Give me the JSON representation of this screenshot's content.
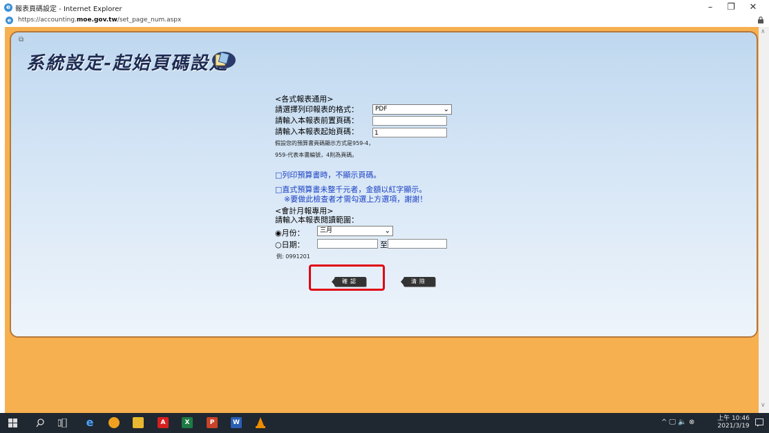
{
  "window": {
    "title": "報表頁碼設定 - Internet Explorer",
    "url_prefix": "https://accounting.",
    "url_domain": "moe.gov.tw",
    "url_path": "/set_page_num.aspx",
    "minimize": "–",
    "maximize": "❐",
    "close": "✕"
  },
  "page": {
    "heading": "系統設定-起始頁碼設定",
    "general_section": "<各式報表通用>",
    "format_label": "請選擇列印報表的格式：",
    "format_value": "PDF",
    "front_page_label": "請輸入本報表前置頁碼：",
    "front_page_value": "",
    "start_page_label": "請輸入本報表起始頁碼：",
    "start_page_value": "1",
    "hint_line1": "假設您的預算書頁碼顯示方式是959-4，",
    "hint_line2": "959-代表本書編號，4則為頁碼。",
    "checkbox1_label": "□列印預算書時，不顯示頁碼。",
    "checkbox2_label": "□直式預算書未整千元者，金額以紅字顯示。",
    "checkbox2_note": "※要做此檢查者才需勾選上方選項，謝謝！",
    "monthly_section": "<會計月報專用>",
    "range_label": "請輸入本報表閱讀範圍：",
    "month_radio_label": "◉月份：",
    "month_value": "三月",
    "date_radio_label": "○日期：",
    "date_to": "至",
    "example": "例: 0991201",
    "confirm_button": "確認",
    "clear_button": "清除"
  },
  "taskbar": {
    "clock_time": "上午 10:46",
    "clock_date": "2021/3/19",
    "tray_icons": "^ 🖵 🔈 ⊗"
  },
  "colors": {
    "page_bg": "#f7b04f",
    "panel_border": "#b5773a",
    "highlight": "#e0000e",
    "link_blue": "#1a40c4"
  }
}
